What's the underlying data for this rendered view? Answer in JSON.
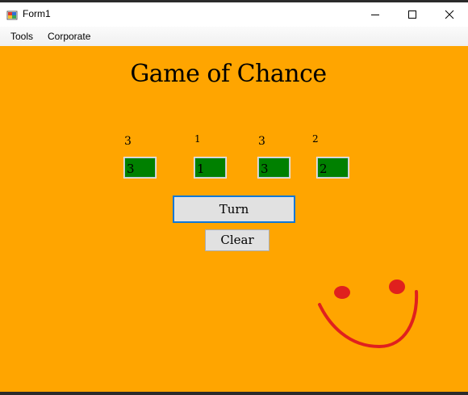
{
  "window": {
    "title": "Form1"
  },
  "menu": {
    "items": [
      "Tools",
      "Corporate"
    ]
  },
  "heading": "Game of Chance",
  "dice": [
    {
      "label": "3",
      "value": "3"
    },
    {
      "label": "1",
      "value": "1"
    },
    {
      "label": "3",
      "value": "3"
    },
    {
      "label": "2",
      "value": "2"
    }
  ],
  "buttons": {
    "turn": "Turn",
    "clear": "Clear"
  },
  "colors": {
    "background": "#ffa500",
    "dice_box": "#008000",
    "smiley": "#e0201e"
  },
  "icons": {
    "app": "app-icon",
    "minimize": "minimize-icon",
    "maximize": "maximize-icon",
    "close": "close-icon"
  }
}
